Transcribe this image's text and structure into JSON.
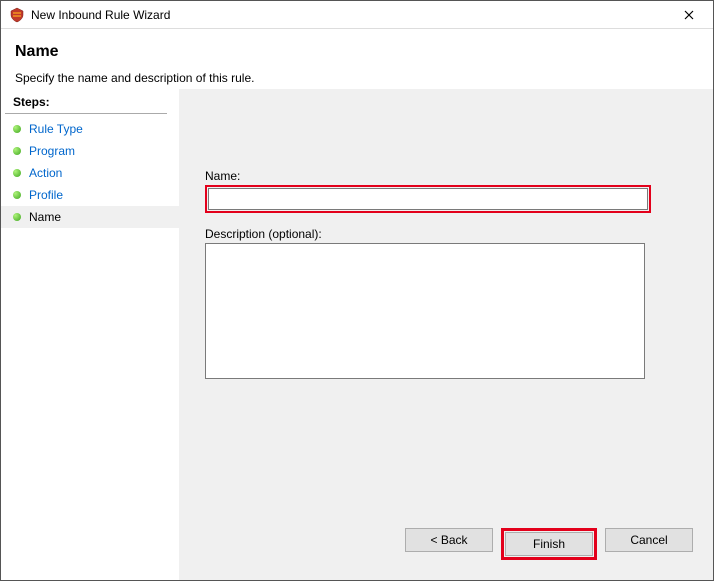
{
  "titlebar": {
    "title": "New Inbound Rule Wizard"
  },
  "header": {
    "title": "Name",
    "subtitle": "Specify the name and description of this rule."
  },
  "steps": {
    "label": "Steps:",
    "items": [
      {
        "label": "Rule Type"
      },
      {
        "label": "Program"
      },
      {
        "label": "Action"
      },
      {
        "label": "Profile"
      },
      {
        "label": "Name"
      }
    ]
  },
  "form": {
    "name_label": "Name:",
    "name_value": "",
    "desc_label": "Description (optional):",
    "desc_value": ""
  },
  "buttons": {
    "back": "< Back",
    "finish": "Finish",
    "cancel": "Cancel"
  },
  "highlight_color": "#e3001b"
}
